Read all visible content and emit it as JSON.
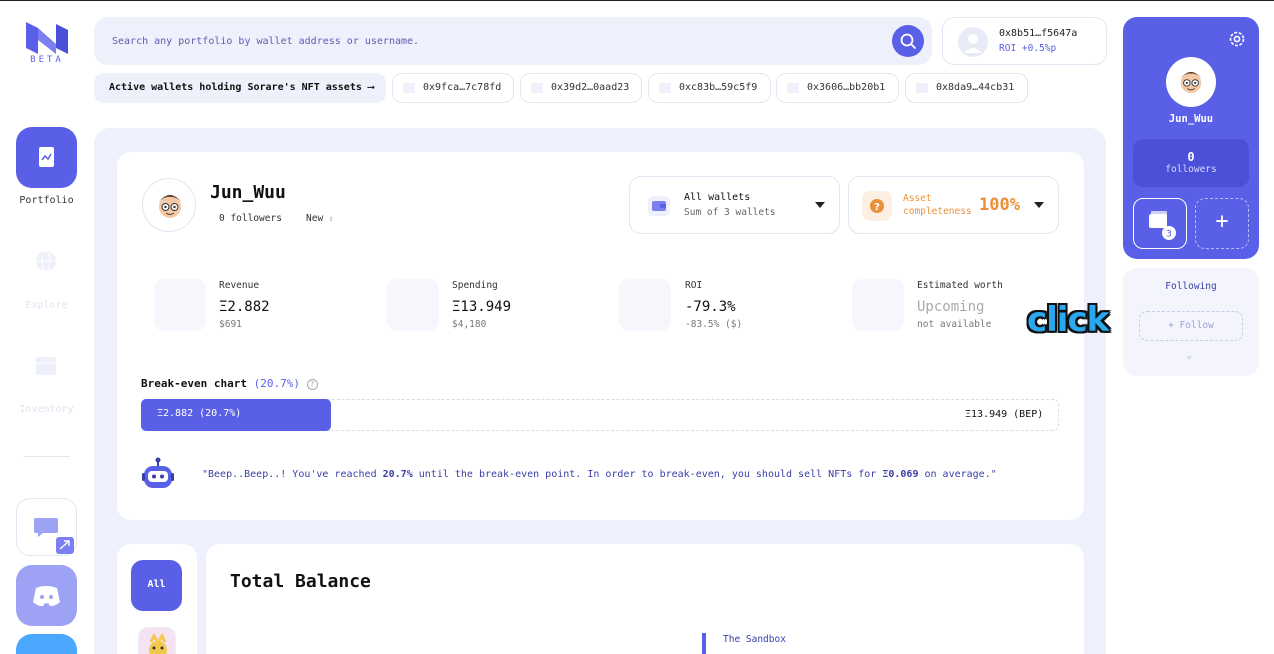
{
  "logo": {
    "badge": "BETA"
  },
  "search": {
    "placeholder": "Search any portfolio by wallet address or username."
  },
  "header_wallet": {
    "address": "0x8b51…f5647a",
    "roi": "ROI +0.5%p"
  },
  "active_wallets": {
    "label": "Active wallets holding Sorare's NFT assets ⟶",
    "wallets": [
      "0x9fca…7c78fd",
      "0x39d2…0aad23",
      "0xc83b…59c5f9",
      "0x3606…bb20b1",
      "0x8da9…44cb31"
    ]
  },
  "nav": {
    "portfolio": "Portfolio",
    "explore": "Explore",
    "inventory": "Inventory"
  },
  "profile": {
    "name": "Jun_Wuu",
    "followers": "0 followers",
    "sort": "New"
  },
  "wallet_select": {
    "title": "All wallets",
    "subtitle": "Sum of 3 wallets"
  },
  "completeness": {
    "label": "Asset completeness",
    "value": "100%"
  },
  "stats": [
    {
      "label": "Revenue",
      "value": "Ξ2.882",
      "sub": "$691"
    },
    {
      "label": "Spending",
      "value": "Ξ13.949",
      "sub": "$4,180"
    },
    {
      "label": "ROI",
      "value": "-79.3%",
      "sub": "-83.5% ($)"
    },
    {
      "label": "Estimated worth",
      "value": "Upcoming",
      "sub": "not available"
    }
  ],
  "breakeven": {
    "title": "Break-even chart",
    "pct_label": "(20.7%)",
    "progress": 0.207,
    "fill_label": "Ξ2.882 (20.7%)",
    "end_label": "Ξ13.949 (BEP)"
  },
  "bot_message": {
    "part1": "\"Beep..Beep..! You've reached ",
    "pct": "20.7%",
    "part2": " until the break-even point. In order to break-even, you should sell NFTs for ",
    "avg": "Ξ0.069",
    "part3": " on average.\""
  },
  "filters": {
    "all": "All"
  },
  "balance": {
    "title": "Total Balance",
    "legend_first": "The Sandbox"
  },
  "right_panel": {
    "name": "Jun_Wuu",
    "followers_count": "0",
    "followers_label": "followers",
    "wallet_count": "3"
  },
  "following_panel": {
    "title": "Following",
    "follow_label": "+  Follow"
  },
  "overlay": {
    "click_text": "click"
  },
  "colors": {
    "accent": "#5a5fe8",
    "orange": "#e8913a",
    "overlay_blue": "#29a8ef"
  }
}
